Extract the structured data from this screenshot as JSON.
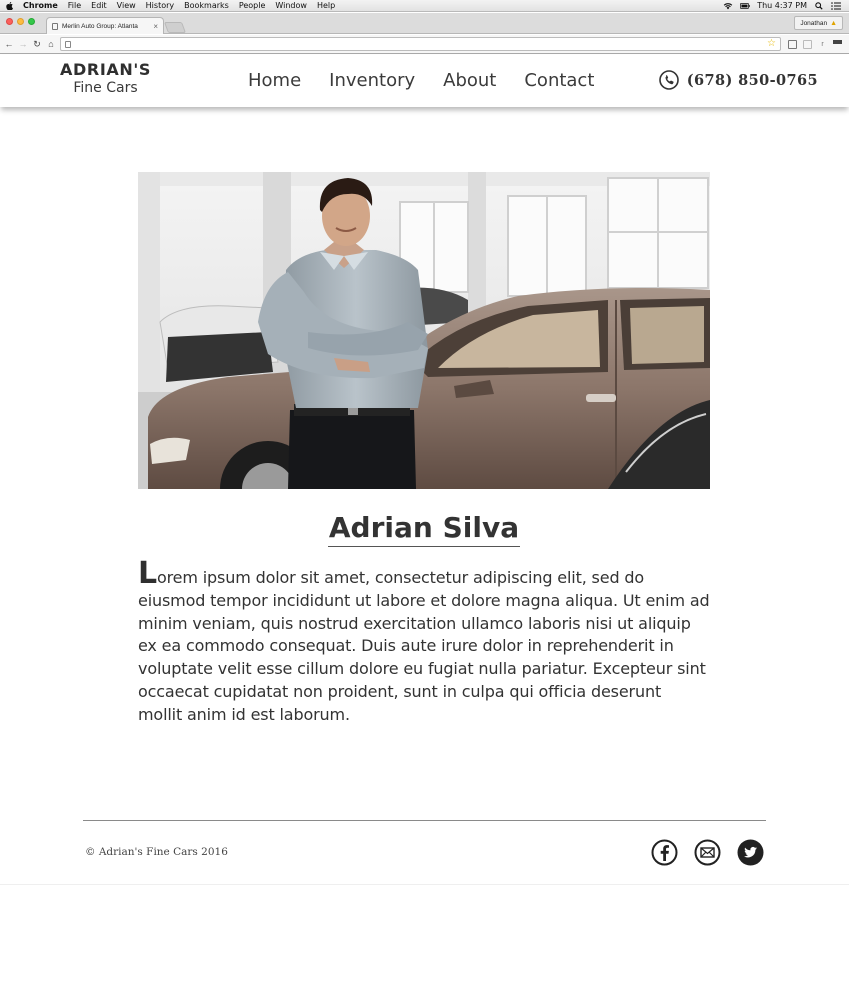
{
  "os_menubar": {
    "app_name": "Chrome",
    "menus": [
      "File",
      "Edit",
      "View",
      "History",
      "Bookmarks",
      "People",
      "Window",
      "Help"
    ],
    "clock": "Thu 4:37 PM"
  },
  "browser": {
    "tab_title": "Merlin Auto Group: Atlanta",
    "profile_name": "Jonathan",
    "url": ""
  },
  "site": {
    "logo_line1": "ADRIAN'S",
    "logo_line2": "Fine Cars",
    "nav": [
      "Home",
      "Inventory",
      "About",
      "Contact"
    ],
    "phone": "(678) 850-0765"
  },
  "profile": {
    "name": "Adrian Silva",
    "bio_initial": "L",
    "bio_rest": "orem ipsum dolor sit amet, consectetur adipiscing elit, sed do eiusmod tempor incididunt ut labore et dolore magna aliqua. Ut enim ad minim veniam, quis nostrud exercitation ullamco laboris nisi ut aliquip ex ea commodo consequat. Duis aute irure dolor in reprehenderit in voluptate velit esse cillum dolore eu fugiat nulla pariatur. Excepteur sint occaecat cupidatat non proident, sunt in culpa qui officia deserunt mollit anim id est laborum."
  },
  "footer": {
    "copyright": "© Adrian's Fine Cars 2016",
    "social": [
      "facebook-icon",
      "email-icon",
      "twitter-icon"
    ]
  },
  "colors": {
    "text": "#333333",
    "header_bg": "#ffffff",
    "rule": "#8a8a8a"
  }
}
